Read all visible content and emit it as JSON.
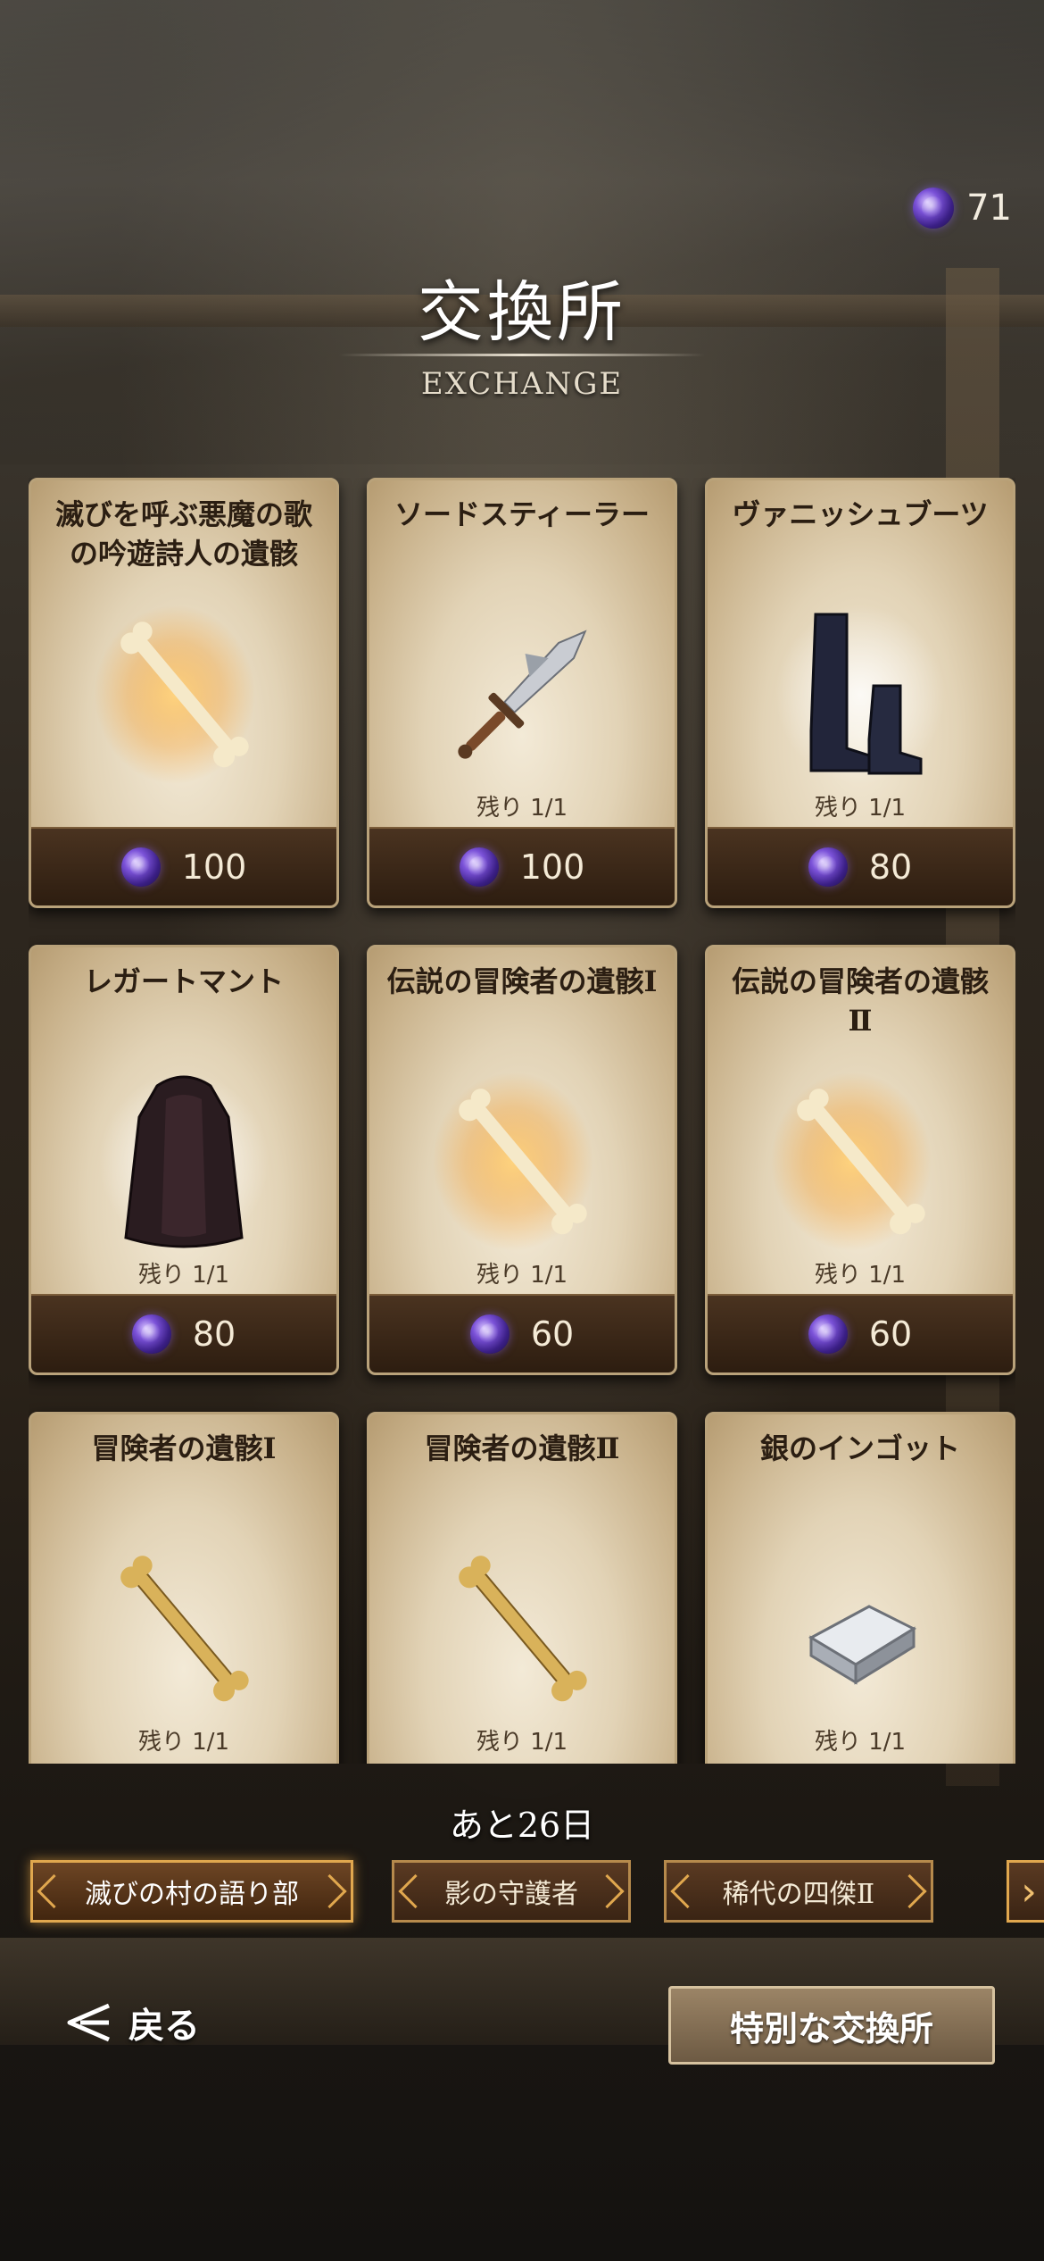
{
  "header": {
    "title": "交換所",
    "subtitle": "EXCHANGE",
    "currency": {
      "icon": "purple-gem-icon",
      "value": "71"
    }
  },
  "items": [
    {
      "name": "滅びを呼ぶ悪魔の歌の吟遊詩人の遺骸",
      "icon": "glowing-bone-icon",
      "remaining": "",
      "price": "100"
    },
    {
      "name": "ソードスティーラー",
      "icon": "sword-icon",
      "remaining": "残り 1/1",
      "price": "100"
    },
    {
      "name": "ヴァニッシュブーツ",
      "icon": "boots-icon",
      "remaining": "残り 1/1",
      "price": "80"
    },
    {
      "name": "レガートマント",
      "icon": "cloak-icon",
      "remaining": "残り 1/1",
      "price": "80"
    },
    {
      "name": "伝説の冒険者の遺骸Ⅰ",
      "icon": "glowing-bone-icon",
      "remaining": "残り 1/1",
      "price": "60"
    },
    {
      "name": "伝説の冒険者の遺骸Ⅱ",
      "icon": "glowing-bone-icon",
      "remaining": "残り 1/1",
      "price": "60"
    },
    {
      "name": "冒険者の遺骸Ⅰ",
      "icon": "bone-icon",
      "remaining": "残り 1/1",
      "price": ""
    },
    {
      "name": "冒険者の遺骸Ⅱ",
      "icon": "bone-icon",
      "remaining": "残り 1/1",
      "price": ""
    },
    {
      "name": "銀のインゴット",
      "icon": "silver-ingot-icon",
      "remaining": "残り 1/1",
      "price": ""
    }
  ],
  "deadline": "あと26日",
  "tabs": [
    {
      "label": "滅びの村の語り部",
      "active": true
    },
    {
      "label": "影の守護者",
      "active": false
    },
    {
      "label": "稀代の四傑Ⅱ",
      "active": false
    }
  ],
  "tab_next_icon": "chevron-right-icon",
  "footer": {
    "back_label": "戻る",
    "back_icon": "back-arrow-icon",
    "special_label": "特別な交換所"
  },
  "colors": {
    "card_border": "#b9a27a",
    "price_bar": "#2d1d10",
    "tab_active_border": "#e0a74e",
    "gem": "#7b52d8"
  }
}
